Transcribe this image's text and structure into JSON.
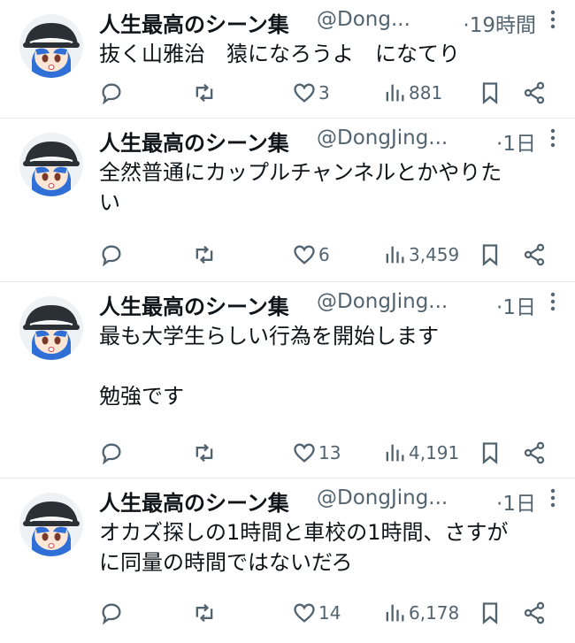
{
  "tweets": [
    {
      "name": "人生最高のシーン集",
      "handle": "@Dong...",
      "time": "·19時間",
      "text": "抜く山雅治　猿になろうよ　になてり",
      "replies": "",
      "retweets": "",
      "likes": "3",
      "views": "881"
    },
    {
      "name": "人生最高のシーン集",
      "handle": "@DongJing...",
      "time": "·1日",
      "text": "全然普通にカップルチャンネルとかやりた\nい",
      "replies": "",
      "retweets": "",
      "likes": "6",
      "views": "3,459"
    },
    {
      "name": "人生最高のシーン集",
      "handle": "@DongJing...",
      "time": "·1日",
      "text": "最も大学生らしい行為を開始します\n\n勉強です",
      "replies": "",
      "retweets": "",
      "likes": "13",
      "views": "4,191"
    },
    {
      "name": "人生最高のシーン集",
      "handle": "@DongJing...",
      "time": "·1日",
      "text": "オカズ探しの1時間と車校の1時間、さすが\nに同量の時間ではないだろ",
      "replies": "",
      "retweets": "",
      "likes": "14",
      "views": "6,178"
    }
  ],
  "icons": {
    "reply": "reply-icon",
    "retweet": "retweet-icon",
    "like": "heart-icon",
    "views": "analytics-icon",
    "bookmark": "bookmark-icon",
    "share": "share-icon",
    "more": "more-vertical-icon"
  },
  "colors": {
    "text": "#0f1419",
    "secondary": "#536471",
    "divider": "#e6e8ea"
  }
}
